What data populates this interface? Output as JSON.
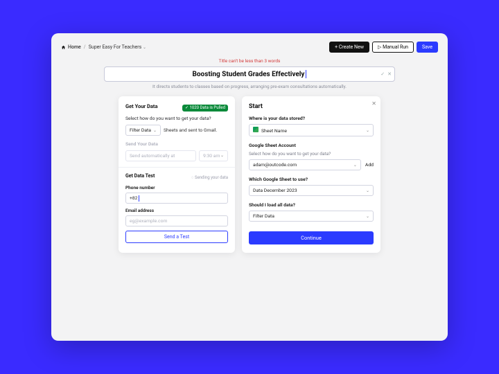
{
  "breadcrumb": {
    "home": "Home",
    "project": "Super Easy For Teachers"
  },
  "topbar": {
    "create": "+  Create New",
    "manual_run": "Manual Run",
    "save": "Save"
  },
  "warning": "Title can't be less than 3 words",
  "title_input": "Boosting Student Grades Effectively",
  "subtitle": "It directs students to classes based on progress, arranging pre-exam consultations automatically.",
  "left": {
    "get_title": "Get Your Data",
    "pill": "✓ 1020 Data is Pulled",
    "get_q": "Select how do you want to get your data?",
    "filter_select": "Filter Data",
    "filter_hint": "Sheets and sent to Gmail.",
    "send_title": "Send Your Data",
    "send_auto": "Send automatically at",
    "send_time": "9:30 am",
    "test_title": "Get Data Test",
    "test_hint": "Sending your data",
    "phone_label": "Phone number",
    "phone_value": "+82",
    "email_label": "Email address",
    "email_placeholder": "eg@example.com",
    "send_test_btn": "Send a Test"
  },
  "right": {
    "start": "Start",
    "q1": "Where is your data stored?",
    "sheet_name": "Sheet Name",
    "q2": "Google Sheet Account",
    "q2_sub": "Select how do you want to get your data?",
    "account": "adam@outcode.com",
    "add": "Add",
    "q3": "Which Google Sheet to use?",
    "sheet_sel": "Data December 2023",
    "q4": "Should I load all data?",
    "load_sel": "Filter Data",
    "continue": "Continue"
  }
}
